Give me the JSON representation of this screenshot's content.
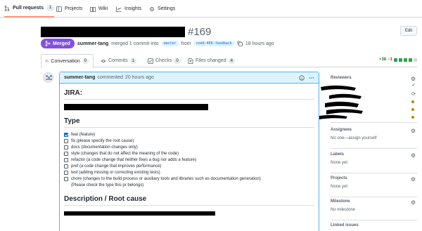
{
  "repo_nav": {
    "tabs": [
      {
        "label": "Pull requests",
        "count": "1",
        "icon": "pull-request-icon"
      },
      {
        "label": "Projects",
        "icon": "table-icon"
      },
      {
        "label": "Wiki",
        "icon": "book-icon"
      },
      {
        "label": "Insights",
        "icon": "graph-icon"
      },
      {
        "label": "Settings",
        "icon": "gear-icon"
      }
    ]
  },
  "header": {
    "number": "#169",
    "edit_label": "Edit",
    "state_label": "Merged",
    "author": "summer-tang",
    "merge_text": "merged 1 commit into",
    "base_branch": "master",
    "from_text": "from",
    "head_branch": "vodd-466-feedback",
    "time": "18 hours ago"
  },
  "pr_tabs": [
    {
      "label": "Conversation",
      "count": "0",
      "icon": "comment-icon"
    },
    {
      "label": "Commits",
      "count": "1",
      "icon": "commit-icon"
    },
    {
      "label": "Checks",
      "count": "0",
      "icon": "checklist-icon"
    },
    {
      "label": "Files changed",
      "count": "4",
      "icon": "file-diff-icon"
    }
  ],
  "diffstat": {
    "additions": "+38",
    "deletions": "−1"
  },
  "comment": {
    "author": "summer-tang",
    "action_text": "commented",
    "time": "20 hours ago",
    "jira_heading": "JIRA:",
    "type_heading": "Type",
    "tasks": [
      {
        "label": "feat (feature)",
        "checked": true
      },
      {
        "label": "fix (please specify the root cause)",
        "checked": false
      },
      {
        "label": "docs (documentation changes only)",
        "checked": false
      },
      {
        "label": "style (changes that do not affect the meaning of the code)",
        "checked": false
      },
      {
        "label": "refactor (a code change that neither fixes a bug nor adds a feature)",
        "checked": false
      },
      {
        "label": "pref (a code change that improves performance)",
        "checked": false
      },
      {
        "label": "test (adding missing or correcting existing tests)",
        "checked": false
      },
      {
        "label": "chore (changes to the build process or auxiliary tools and libraries such as documentation generation)",
        "checked": false
      }
    ],
    "task_note": "(Please check the type this pr belongs)",
    "desc_heading": "Description / Root cause"
  },
  "sidebar": {
    "reviewers_title": "Reviewers",
    "assignees_title": "Assignees",
    "assignees_value": "No one—assign yourself",
    "labels_title": "Labels",
    "labels_value": "None yet",
    "projects_title": "Projects",
    "projects_value": "None yet",
    "milestone_title": "Milestone",
    "milestone_value": "No milestone",
    "linked_title": "Linked issues"
  },
  "colors": {
    "merged": "#8250df",
    "accent": "#0969da",
    "comment_border": "#54aeff",
    "add": "#1a7f37",
    "del": "#cf222e"
  }
}
